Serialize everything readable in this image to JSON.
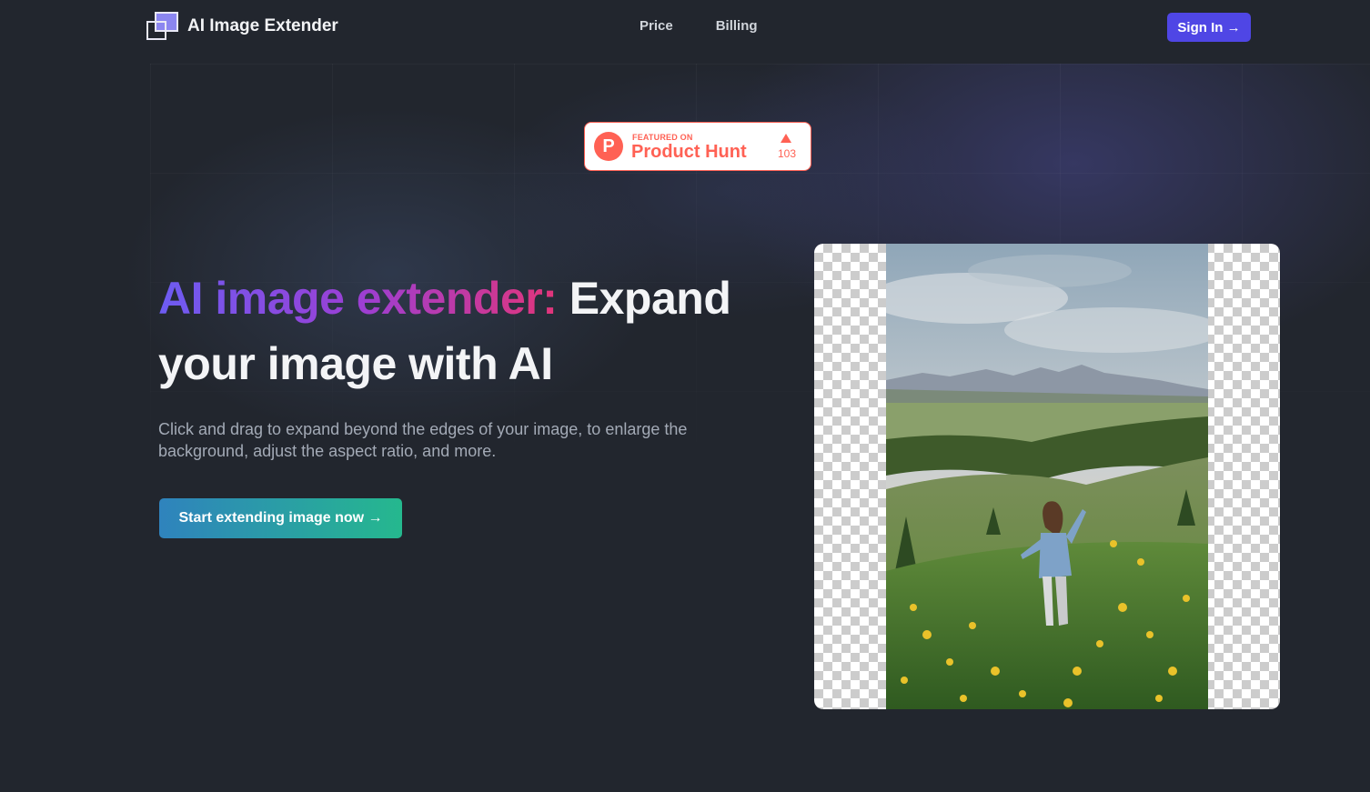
{
  "header": {
    "logo_text": "AI Image Extender",
    "nav": [
      "Price",
      "Billing"
    ],
    "signin_label": "Sign In →"
  },
  "badge": {
    "featured_label": "FEATURED ON",
    "name": "Product Hunt",
    "logo_letter": "P",
    "upvotes": "103"
  },
  "hero": {
    "title_gradient": "AI image extender:",
    "title_rest": " Expand your image with AI",
    "subtitle": "Click and drag to expand beyond the edges of your image, to enlarge the background, adjust the aspect ratio, and more.",
    "cta_label": "Start extending image now →"
  },
  "colors": {
    "background": "#22262e",
    "accent": "#4f46e5",
    "badge": "#ff6154",
    "cta_start": "#2f83bd",
    "cta_end": "#25b88e"
  }
}
